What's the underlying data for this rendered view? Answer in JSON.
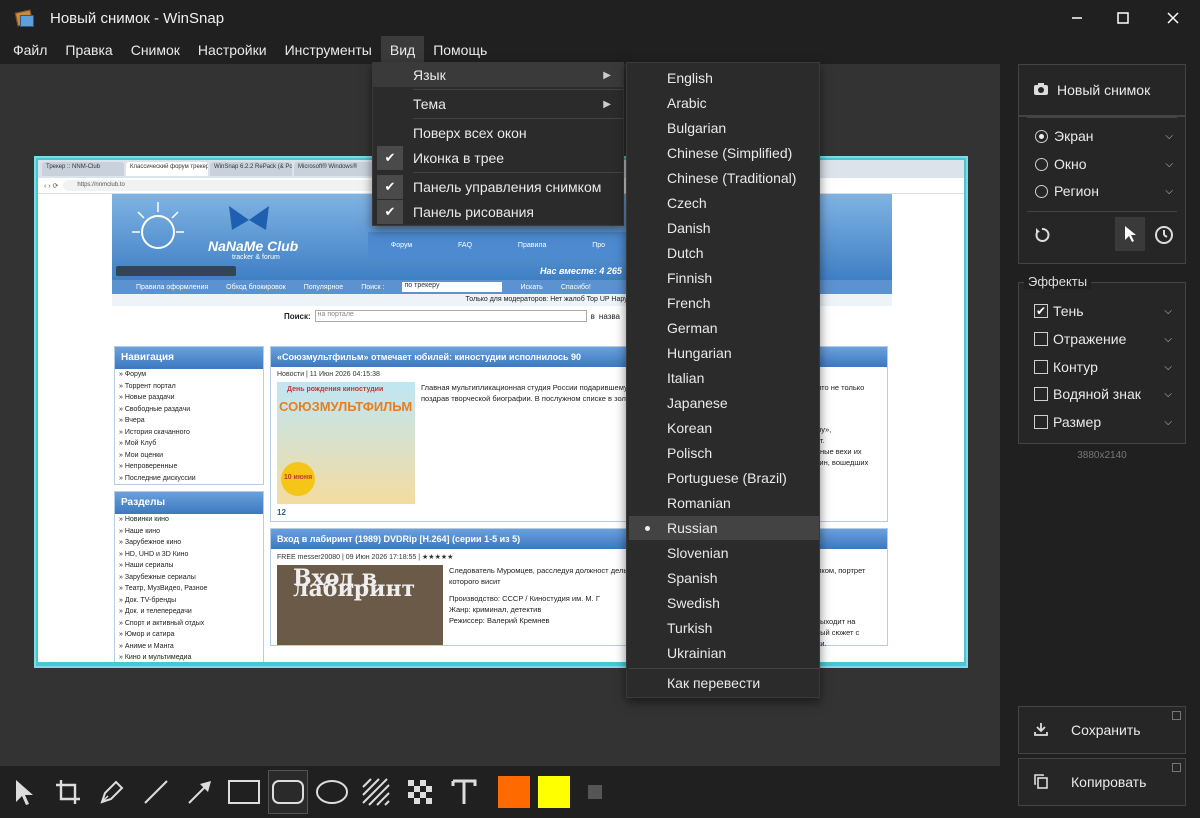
{
  "window": {
    "title": "Новый снимок - WinSnap",
    "minimize_icon": "minimize-icon",
    "maximize_icon": "maximize-icon",
    "close_icon": "close-icon"
  },
  "menubar": [
    "Файл",
    "Правка",
    "Снимок",
    "Настройки",
    "Инструменты",
    "Вид",
    "Помощь"
  ],
  "view_menu": {
    "language": "Язык",
    "theme": "Тема",
    "on_top": "Поверх всех окон",
    "tray_icon": "Иконка в трее",
    "capture_panel": "Панель управления снимком",
    "draw_panel": "Панель рисования"
  },
  "languages": [
    "English",
    "Arabic",
    "Bulgarian",
    "Chinese (Simplified)",
    "Chinese (Traditional)",
    "Czech",
    "Danish",
    "Dutch",
    "Finnish",
    "French",
    "German",
    "Hungarian",
    "Italian",
    "Japanese",
    "Korean",
    "Polisch",
    "Portuguese (Brazil)",
    "Romanian",
    "Russian",
    "Slovenian",
    "Spanish",
    "Swedish",
    "Turkish",
    "Ukrainian"
  ],
  "selected_language": "Russian",
  "translate_link": "Как перевести",
  "side": {
    "new_snapshot": "Новый снимок",
    "modes": [
      "Экран",
      "Окно",
      "Регион"
    ],
    "selected_mode": "Экран",
    "effects_label": "Эффекты",
    "effects": [
      "Тень",
      "Отражение",
      "Контур",
      "Водяной знак",
      "Размер"
    ],
    "effects_checked": [
      "Тень"
    ],
    "size_readout": "3880x2140",
    "save": "Сохранить",
    "copy": "Копировать"
  },
  "colors": {
    "primary": "#ff6a00",
    "secondary": "#ffff00",
    "accent_bg": "#202020"
  },
  "screenshot": {
    "tabs": [
      "Трекер :: NNM-Club",
      "Классический форум трекер | NNM",
      "WinSnap 6.2.2 RePack (& Portable)",
      "Microsoft® Windows®"
    ],
    "url": "https://nnmclub.to",
    "logo": "NaNaMe Club",
    "logo_sub": "tracker & forum",
    "nav": [
      "Форум",
      "FAQ",
      "Правила",
      "Про"
    ],
    "together": "Нас вместе: 4 265",
    "links": [
      "Правила оформления",
      "Обход блокировок",
      "Популярное"
    ],
    "search_label": "Поиск :",
    "search_value": "по трекеру",
    "search_btn": "Искать",
    "thanks": "Спасибо!",
    "mods": "Только для модераторов:   Нет жалоб   Top UP   Нарушители",
    "portal_label": "Поиск:",
    "portal_value": "на портале",
    "portal_in": "в",
    "portal_btn": "назва",
    "nav_title": "Навигация",
    "nav_items": [
      "» Форум",
      "» Торрент портал",
      "» Новые раздачи",
      "» Свободные раздачи",
      "» Вчера",
      "» История скачанного",
      "» Мой Клуб",
      "» Мои оценки",
      "» Непроверенные",
      "» Последние дискуссии"
    ],
    "sections_title": "Разделы",
    "section_items": [
      "» Новинки кино",
      "» Наше кино",
      "» Зарубежное кино",
      "» HD, UHD и 3D Кино",
      "» Наши сериалы",
      "» Зарубежные сериалы",
      "» Театр, МузВидео, Разное",
      "» Док. TV-бренды",
      "» Док. и телепередачи",
      "» Спорт и активный отдых",
      "» Юмор и сатира",
      "» Аниме и Манга",
      "» Кино и мультимедиа"
    ],
    "post1_title": "«Союзмультфильм» отмечает юбилей: киностудии исполнилось 90",
    "post1_meta": "Новости | 11 Июн 2026 04:15:38",
    "post1_body": "Главная мультипликационная студия России подарившему нашей стране множество чуде В день рождения принято не только поздрав творческой биографии. В послужном списке в золотой ( Читать дальше... )",
    "post1_img": "День рождения киностудии",
    "post1_img_big": "СОЮЗМУЛЬТФИЛЬМ",
    "post1_badge": "10 июня",
    "post1_comments": "12",
    "post2_title": "Вход в лабиринт (1989) DVDRip [H.264] (серии 1-5 из 5)",
    "post2_meta": "FREE messer20080 | 09 Июн 2026 17:18:55 | ★★★★★",
    "post2_body": "Следователь Муромцев, расследуя должност дельцов теневой экономики. Параллельно с врачом-алхимиком, портрет которого висит",
    "post2_prod": "Производство: СССР / Киностудия им. М. Г",
    "post2_genre": "Жанр: криминал, детектив",
    "post2_dir": "Режиссер: Валерий Кремнев",
    "post2_img": "Вход в лабиринт",
    "right_frag1": "му»,",
    "right_frag2": "ет.",
    "right_frag3": "вные вехи их",
    "right_frag4": "тин, вошедших",
    "right_frag5": "выходит на",
    "right_frag6": "ный сюжет с",
    "right_frag7": "ии."
  },
  "toolbar_icons": [
    "pointer-icon",
    "crop-icon",
    "pen-icon",
    "line-icon",
    "arrow-icon",
    "rectangle-icon",
    "rounded-rectangle-icon",
    "ellipse-icon",
    "hatch-icon",
    "pixelate-icon",
    "text-icon"
  ]
}
